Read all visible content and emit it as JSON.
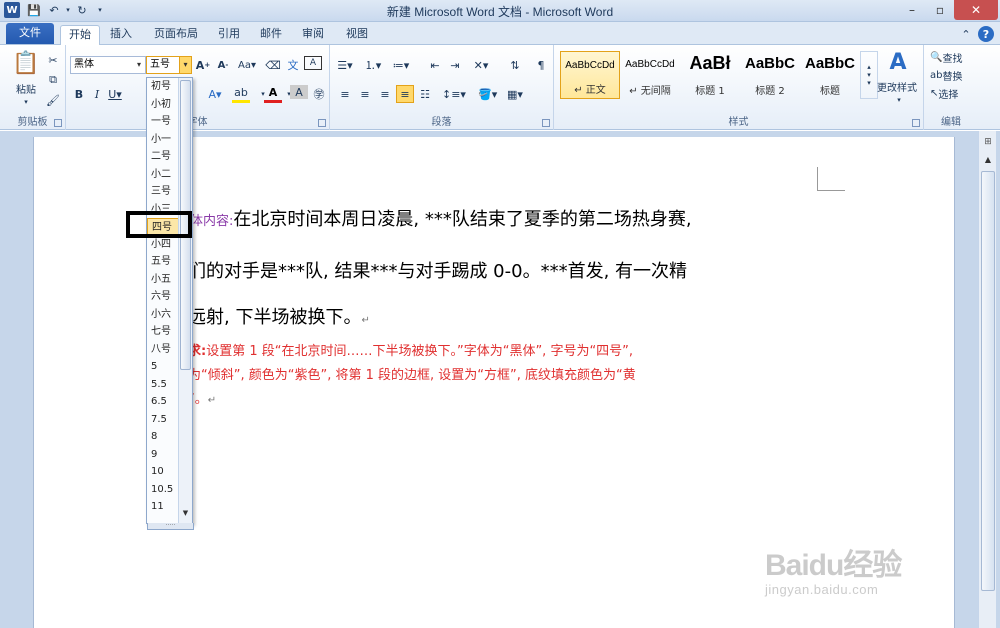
{
  "window": {
    "title": "新建 Microsoft Word 文档 - Microsoft Word"
  },
  "tabs": {
    "file": "文件",
    "items": [
      "开始",
      "插入",
      "页面布局",
      "引用",
      "邮件",
      "审阅",
      "视图"
    ]
  },
  "ribbon": {
    "clipboard": {
      "label": "剪贴板",
      "paste": "粘贴"
    },
    "font": {
      "label": "字体",
      "font_name": "黑体",
      "font_size": "五号"
    },
    "paragraph": {
      "label": "段落"
    },
    "styles": {
      "label": "样式",
      "items": [
        {
          "preview": "AaBbCcDd",
          "name": "↵ 正文"
        },
        {
          "preview": "AaBbCcDd",
          "name": "↵ 无间隔"
        },
        {
          "preview": "AaBł",
          "name": "标题 1"
        },
        {
          "preview": "AaBbC",
          "name": "标题 2"
        },
        {
          "preview": "AaBbC",
          "name": "标题"
        }
      ],
      "change_styles": "更改样式"
    },
    "editing": {
      "label": "编辑",
      "find": "查找",
      "replace": "替换",
      "select": "选择"
    }
  },
  "dropdown": {
    "items": [
      "初号",
      "小初",
      "一号",
      "小一",
      "二号",
      "小二",
      "三号",
      "小三",
      "四号",
      "小四",
      "五号",
      "小五",
      "六号",
      "小六",
      "七号",
      "八号",
      "5",
      "5.5",
      "6.5",
      "7.5",
      "8",
      "9",
      "10",
      "10.5",
      "11"
    ],
    "highlighted": "四号"
  },
  "document": {
    "line1_label": "体内容:",
    "line1": "在北京时间本周日凌晨, ***队结束了夏季的第二场热身赛,",
    "line2": "们的对手是***队, 结果***与对手踢成 0-0。***首发, 有一次精",
    "line3": "远射, 下半场被换下。",
    "req1_label": "求:",
    "req1": "设置第 1 段“在北京时间……下半场被换下。”字体为“黑体”,      字号为“四号”,",
    "req2": "为“倾斜”, 颜色为“紫色”, 将第 1 段的边框,      设置为“方框”, 底纹填充颜色为“黄",
    "req3": "”。"
  },
  "watermark": {
    "logo": "Baidu经验",
    "url": "jingyan.baidu.com"
  }
}
